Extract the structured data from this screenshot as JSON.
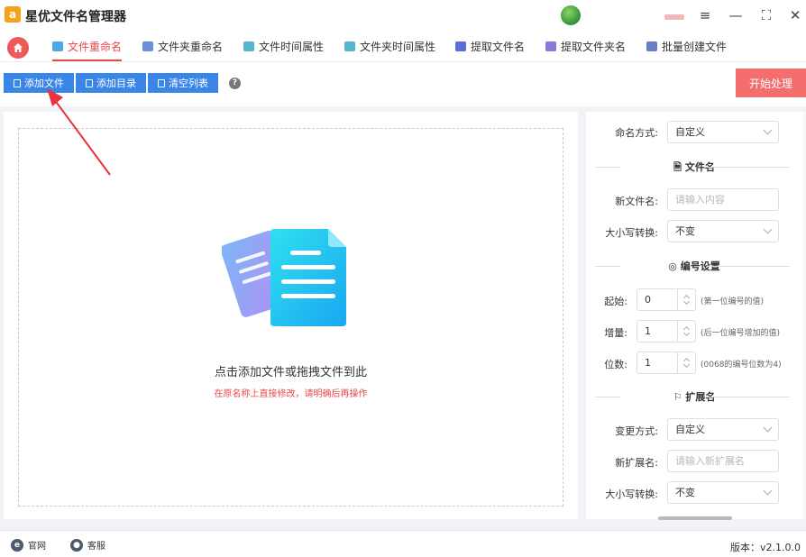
{
  "app": {
    "title": "星优文件名管理器",
    "logo": "a"
  },
  "window_controls": {
    "settings_icon": "≡",
    "minimize_icon": "—",
    "maximize_icon": "⛶",
    "close_icon": "✕"
  },
  "tabs": [
    {
      "label": "文件重命名",
      "active": true,
      "icon": "rename-icon"
    },
    {
      "label": "文件夹重命名",
      "active": false,
      "icon": "folder-rename-icon"
    },
    {
      "label": "文件时间属性",
      "active": false,
      "icon": "file-time-icon"
    },
    {
      "label": "文件夹时间属性",
      "active": false,
      "icon": "folder-time-icon"
    },
    {
      "label": "提取文件名",
      "active": false,
      "icon": "extract-filename-icon"
    },
    {
      "label": "提取文件夹名",
      "active": false,
      "icon": "extract-foldername-icon"
    },
    {
      "label": "批量创建文件",
      "active": false,
      "icon": "batch-create-icon"
    }
  ],
  "toolbar": {
    "add_file": "添加文件",
    "add_dir": "添加目录",
    "clear_list": "清空列表",
    "help": "?",
    "start": "开始处理"
  },
  "drop_zone": {
    "hint": "点击添加文件或拖拽文件到此",
    "subhint": "在原名称上直接修改，请明确后再操作"
  },
  "settings": {
    "naming_mode": {
      "label": "命名方式:",
      "value": "自定义"
    },
    "filename_section": "文件名",
    "new_filename": {
      "label": "新文件名:",
      "placeholder": "请输入内容"
    },
    "case_convert": {
      "label": "大小写转换:",
      "value": "不变"
    },
    "numbering_section": "编号设置",
    "start": {
      "label": "起始:",
      "value": "0",
      "note": "(第一位编号的值)"
    },
    "increment": {
      "label": "增量:",
      "value": "1",
      "note": "(后一位编号增加的值)"
    },
    "digits": {
      "label": "位数:",
      "value": "1",
      "note": "(0068的编号位数为4)"
    },
    "extension_section": "扩展名",
    "change_mode": {
      "label": "变更方式:",
      "value": "自定义"
    },
    "new_extension": {
      "label": "新扩展名:",
      "placeholder": "请输入新扩展名"
    },
    "ext_case_convert": {
      "label": "大小写转换:",
      "value": "不变"
    }
  },
  "statusbar": {
    "website": "官网",
    "support": "客服",
    "version": "版本：v2.1.0.0"
  },
  "colors": {
    "accent": "#e8494a",
    "primary": "#3a86e8",
    "start_button": "#f46e6e"
  }
}
